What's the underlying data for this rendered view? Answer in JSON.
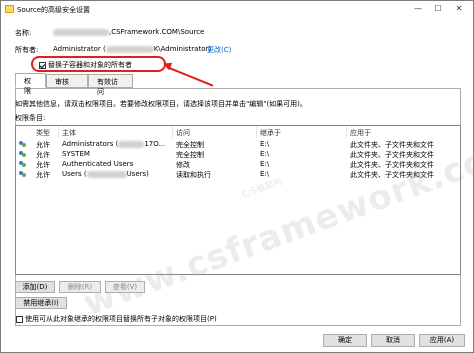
{
  "window": {
    "title": "Source的高级安全设置",
    "minimize_glyph": "—",
    "maximize_glyph": "☐",
    "close_glyph": "✕"
  },
  "header": {
    "name_label": "名称:",
    "name_value": ",CSFramework.COM\\Source",
    "owner_label": "所有者:",
    "owner_value_prefix": "Administrator (",
    "owner_value_suffix": "K\\Administrator)",
    "change_link": "更改(C)",
    "replace_owner_checkbox": {
      "label": "替换子容器和对象的所有者",
      "checked": true
    }
  },
  "tabs": [
    {
      "label": "权限",
      "active": true
    },
    {
      "label": "审核",
      "active": false
    },
    {
      "label": "有效访问",
      "active": false
    }
  ],
  "permissions": {
    "info_text": "如需其他信息，请双击权限项目。若要修改权限项目，请选择该项目并单击\"编辑\"(如果可用)。",
    "entries_label": "权限条目:",
    "columns": [
      "类型",
      "主体",
      "访问",
      "继承于",
      "应用于"
    ],
    "rows": [
      {
        "type": "允许",
        "principal": "Administrators (",
        "principal_suffix": "17O...",
        "access": "完全控制",
        "inherited_from": "E:\\",
        "applies_to": "此文件夹、子文件夹和文件"
      },
      {
        "type": "允许",
        "principal": "SYSTEM",
        "principal_suffix": "",
        "access": "完全控制",
        "inherited_from": "E:\\",
        "applies_to": "此文件夹、子文件夹和文件"
      },
      {
        "type": "允许",
        "principal": "Authenticated Users",
        "principal_suffix": "",
        "access": "修改",
        "inherited_from": "E:\\",
        "applies_to": "此文件夹、子文件夹和文件"
      },
      {
        "type": "允许",
        "principal": "Users (",
        "principal_suffix": "Users)",
        "access": "读取和执行",
        "inherited_from": "E:\\",
        "applies_to": "此文件夹、子文件夹和文件"
      }
    ]
  },
  "buttons": {
    "add": "添加(D)",
    "remove": "删除(R)",
    "view": "查看(V)",
    "disable_inheritance": "禁用继承(I)",
    "ok": "确定",
    "cancel": "取消",
    "apply": "应用(A)"
  },
  "replace_child_checkbox": {
    "label": "使用可从此对象继承的权限项目替换所有子对象的权限项目(P)",
    "checked": false
  },
  "watermark": {
    "main": "www.csframework.com",
    "small": "C/S框架网"
  }
}
